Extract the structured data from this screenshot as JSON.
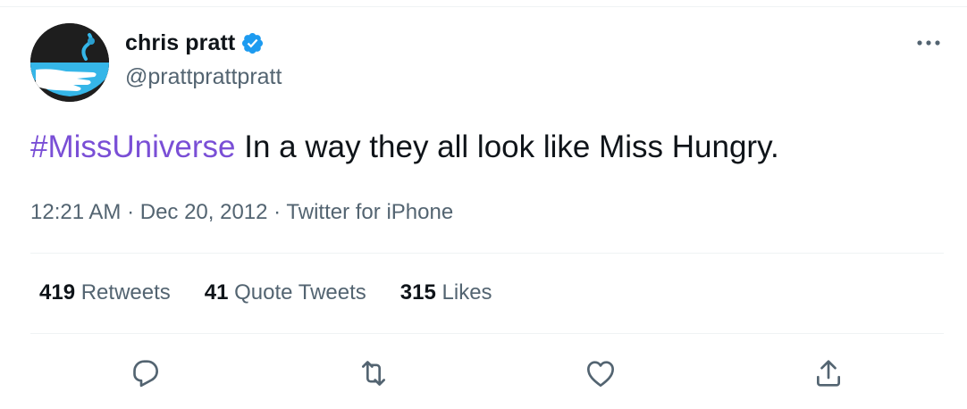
{
  "user": {
    "name": "chris pratt",
    "handle": "@prattprattpratt",
    "verified": true
  },
  "tweet": {
    "hashtag": "#MissUniverse",
    "text": " In a way they all look like Miss Hungry.",
    "time": "12:21 AM",
    "date": "Dec 20, 2012",
    "separator": " · ",
    "source": "Twitter for iPhone"
  },
  "stats": {
    "retweets_count": "419",
    "retweets_label": "Retweets",
    "quotes_count": "41",
    "quotes_label": "Quote Tweets",
    "likes_count": "315",
    "likes_label": "Likes"
  },
  "actions": [
    "reply-icon",
    "retweet-icon",
    "like-icon",
    "share-icon"
  ],
  "colors": {
    "text": "#0f1419",
    "secondary": "#536471",
    "hashtag": "#7a4fd6",
    "verified": "#1d9bf0",
    "border": "#eff3f4"
  }
}
